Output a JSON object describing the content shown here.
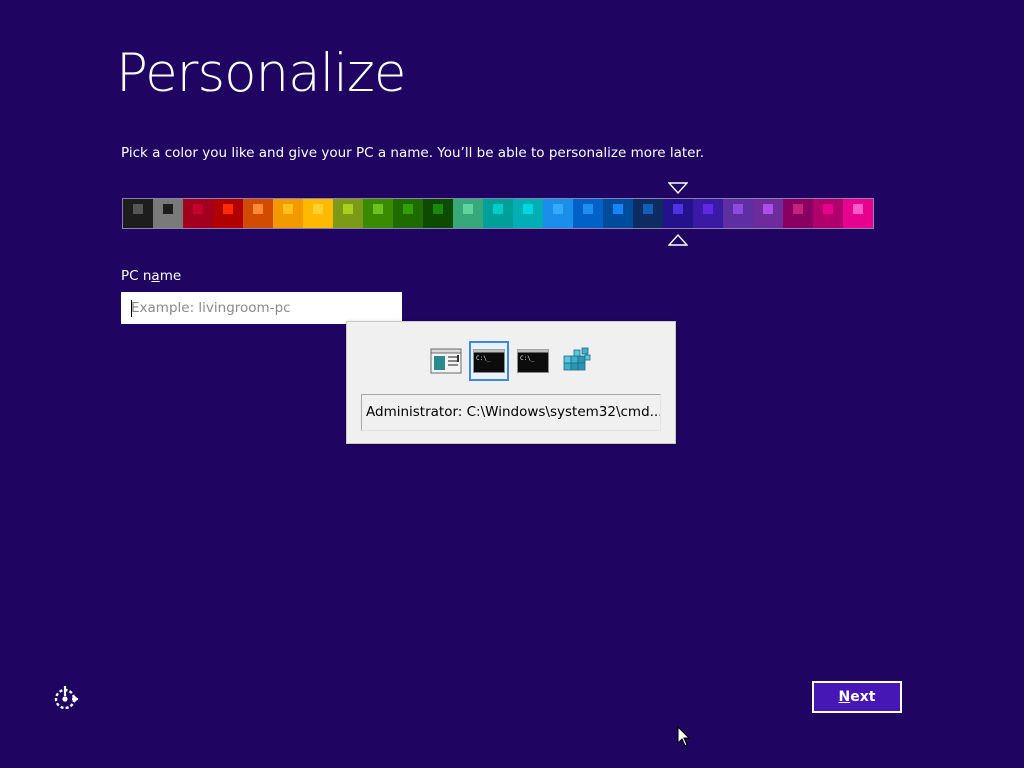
{
  "header": {
    "title": "Personalize",
    "subtitle": "Pick a color you like and give your PC a name. You’ll be able to personalize more later."
  },
  "color_picker": {
    "selected_index": 18,
    "swatches": [
      {
        "bg": "#1d1d1d",
        "accent": "#555555"
      },
      {
        "bg": "#7a7a7a",
        "accent": "#1d1d1d"
      },
      {
        "bg": "#a2001e",
        "accent": "#c4002b"
      },
      {
        "bg": "#b00000",
        "accent": "#ff2a00"
      },
      {
        "bg": "#d24b00",
        "accent": "#ff8a36"
      },
      {
        "bg": "#f29a00",
        "accent": "#ffc11a"
      },
      {
        "bg": "#ffba00",
        "accent": "#ffd230"
      },
      {
        "bg": "#7b9a16",
        "accent": "#a6d11c"
      },
      {
        "bg": "#3a8b00",
        "accent": "#6cc31b"
      },
      {
        "bg": "#1f6b00",
        "accent": "#2ea100"
      },
      {
        "bg": "#0d4b00",
        "accent": "#1b8a00"
      },
      {
        "bg": "#37a87a",
        "accent": "#5ed49e"
      },
      {
        "bg": "#00a09a",
        "accent": "#00cdc6"
      },
      {
        "bg": "#00afb5",
        "accent": "#00d8df"
      },
      {
        "bg": "#1b8dea",
        "accent": "#37a9ff"
      },
      {
        "bg": "#0062c9",
        "accent": "#1e8ef0"
      },
      {
        "bg": "#004c9c",
        "accent": "#1585ff"
      },
      {
        "bg": "#0d2c61",
        "accent": "#1060b8"
      },
      {
        "bg": "#24128d",
        "accent": "#4f33e0"
      },
      {
        "bg": "#3a1aa5",
        "accent": "#6226e8"
      },
      {
        "bg": "#5d2fa3",
        "accent": "#8d4ae0"
      },
      {
        "bg": "#6d2b9b",
        "accent": "#b04ce8"
      },
      {
        "bg": "#8a0062",
        "accent": "#c4217f"
      },
      {
        "bg": "#b0006e",
        "accent": "#e6008a"
      },
      {
        "bg": "#e8008f",
        "accent": "#ff59cb"
      }
    ]
  },
  "pc_name": {
    "label_before": "PC n",
    "label_underlined": "a",
    "label_after": "me",
    "placeholder": "Example: livingroom-pc",
    "value": ""
  },
  "task_switcher": {
    "selected_index": 1,
    "items": [
      {
        "icon": "window-app-icon"
      },
      {
        "icon": "command-prompt-icon"
      },
      {
        "icon": "command-prompt-icon"
      },
      {
        "icon": "registry-editor-icon"
      }
    ],
    "caption": "Administrator: C:\\Windows\\system32\\cmd...."
  },
  "footer": {
    "ease_of_access_icon": "ease-of-access-icon",
    "next_label_underlined": "N",
    "next_label_rest": "ext"
  },
  "colors": {
    "background": "#1f0561",
    "next_button": "#4617b4",
    "selection_border": "#3b8ae0"
  }
}
